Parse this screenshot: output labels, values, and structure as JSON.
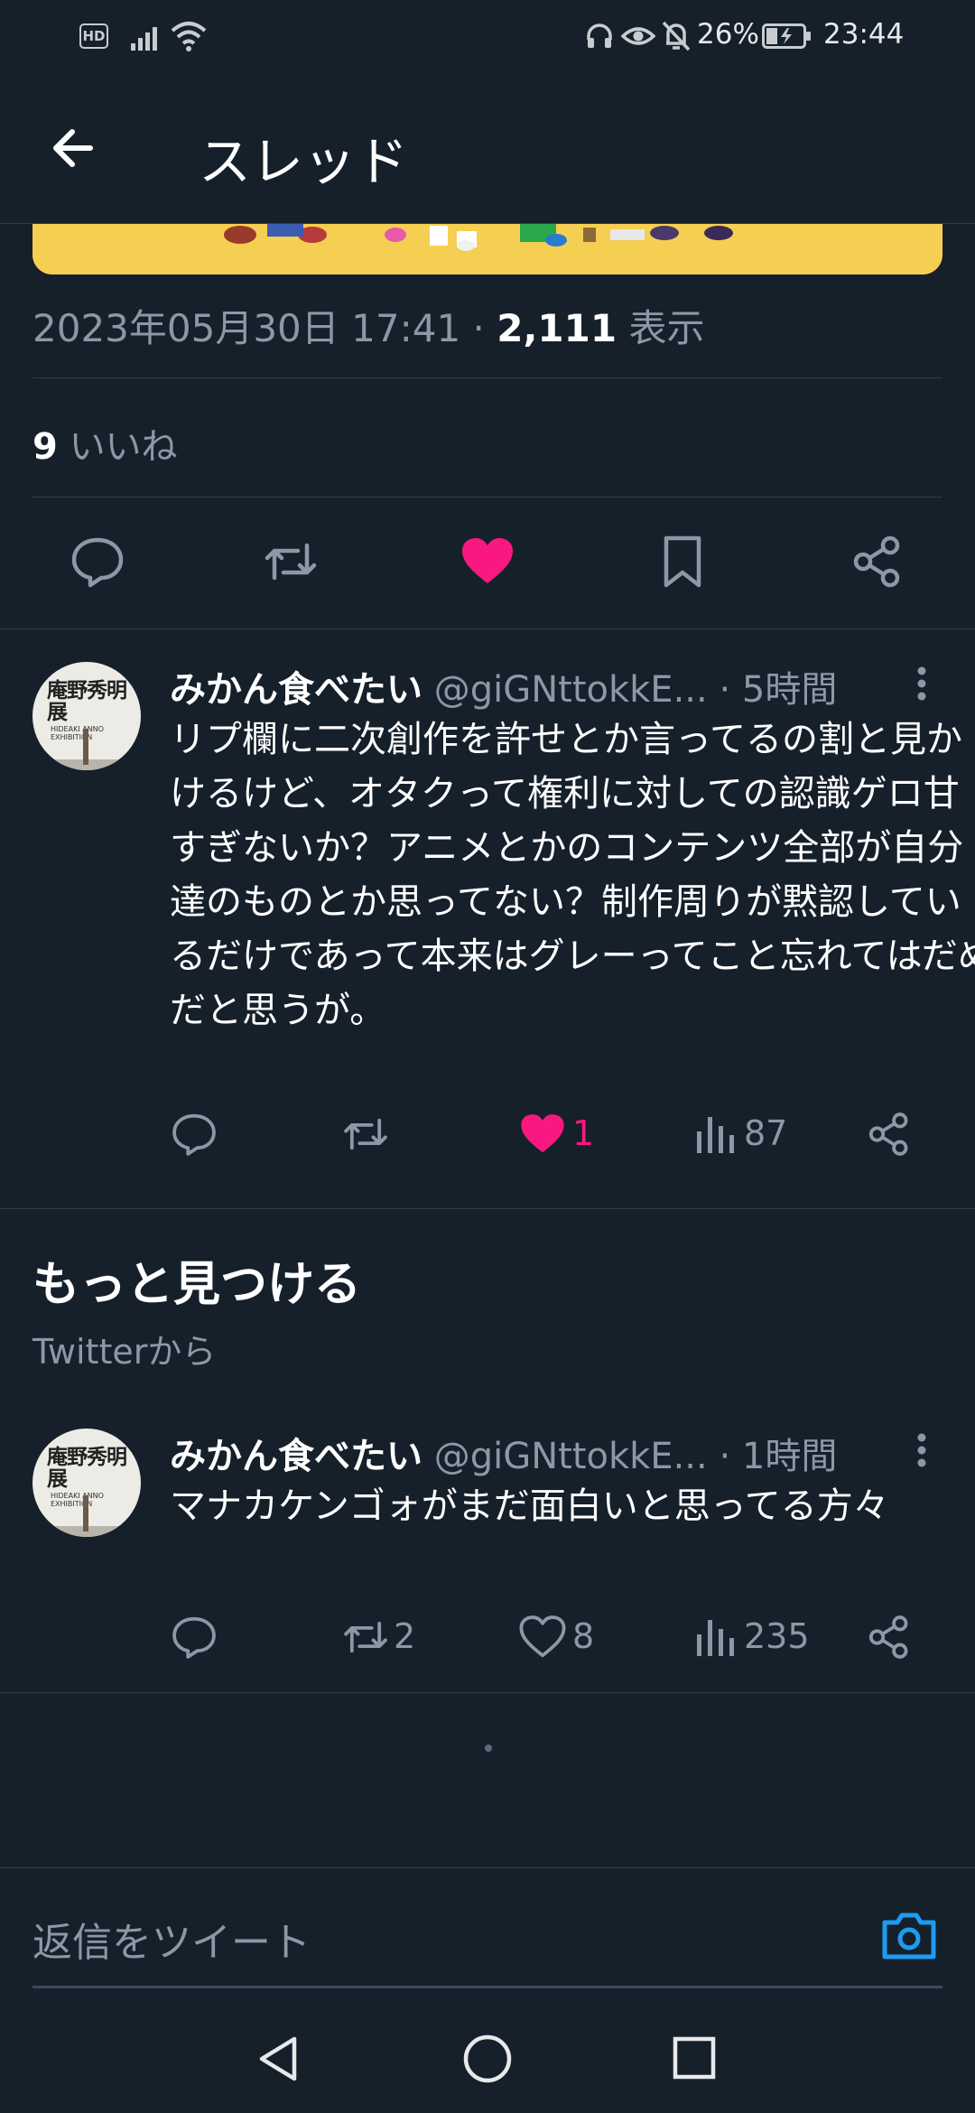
{
  "status_bar": {
    "hd": "HD",
    "battery": "26%",
    "time": "23:44"
  },
  "header": {
    "title": "スレッド"
  },
  "main_tweet": {
    "date": "2023年05月30日 17:41",
    "separator": "·",
    "views_count": "2,111",
    "views_label": "表示",
    "likes_count": "9",
    "likes_label": "いいね",
    "liked": true
  },
  "replies": [
    {
      "display_name": "みかん食べたい",
      "handle": "@giGNttokkE...",
      "time": "· 5時間",
      "avatar_text": "庵野秀明展",
      "avatar_sub": "HIDEAKI ANNO EXHIBITION",
      "text": "リプ欄に二次創作を許せとか言ってるの割と見かけるけど、オタクって権利に対しての認識ゲロ甘すぎないか？アニメとかのコンテンツ全部が自分達のものとか思ってない？制作周りが黙認しているだけであって本来はグレーってこと忘れてはだめだと思うが。",
      "retweets": "",
      "likes": "1",
      "liked": true,
      "views": "87"
    }
  ],
  "discover": {
    "title": "もっと見つける",
    "subtitle": "Twitterから",
    "tweets": [
      {
        "display_name": "みかん食べたい",
        "handle": "@giGNttokkE...",
        "time": "· 1時間",
        "avatar_text": "庵野秀明展",
        "avatar_sub": "HIDEAKI ANNO EXHIBITION",
        "text": "マナカケンゴォがまだ面白いと思ってる方々",
        "retweets": "2",
        "likes": "8",
        "liked": false,
        "views": "235"
      }
    ]
  },
  "reply_bar": {
    "placeholder": "返信をツイート"
  },
  "colors": {
    "background": "#15202b",
    "secondary_text": "#8b98a5",
    "like_pink": "#f91880",
    "accent_blue": "#1d9bf0",
    "divider": "#2f3c4a"
  },
  "icons": [
    "back-arrow-icon",
    "reply-icon",
    "retweet-icon",
    "heart-icon",
    "bookmark-icon",
    "share-icon",
    "views-icon",
    "more-icon",
    "camera-icon"
  ]
}
